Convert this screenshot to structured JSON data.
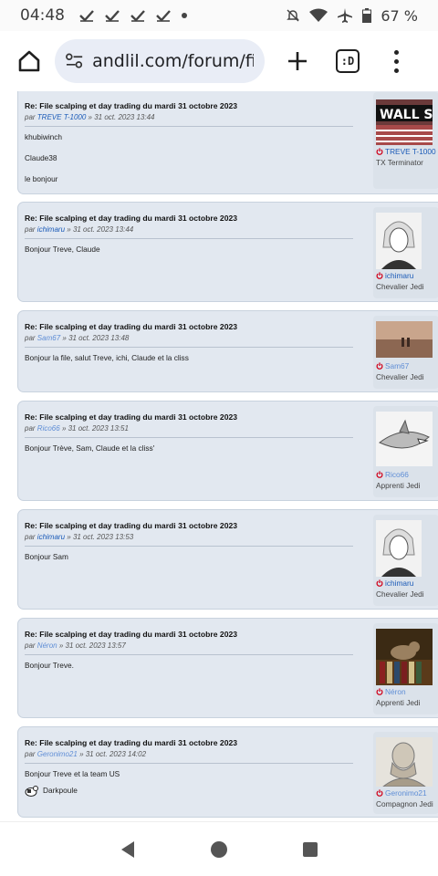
{
  "status": {
    "time": "04:48",
    "battery": "67 %"
  },
  "browser": {
    "url": "andlil.com/forum/fil",
    "tabs_label": ":D"
  },
  "posts": [
    {
      "title": "Re: File scalping et day trading du mardi 31 octobre 2023",
      "by": "par",
      "author": "TREVE T-1000",
      "date": "» 31 oct. 2023 13:44",
      "content": [
        "khubiwinch",
        "Claude38",
        "le bonjour"
      ],
      "username": "TREVE T-1000",
      "rank": "TX Terminator",
      "avatar": "wall-st-avatar",
      "avatar_text": "WALL ST"
    },
    {
      "title": "Re: File scalping et day trading du mardi 31 octobre 2023",
      "by": "par",
      "author": "ichimaru",
      "date": "» 31 oct. 2023 13:44",
      "content": [
        "Bonjour Treve, Claude"
      ],
      "username": "ichimaru",
      "rank": "Chevalier Jedi",
      "avatar": "anime-character-avatar"
    },
    {
      "title": "Re: File scalping et day trading du mardi 31 octobre 2023",
      "by": "par",
      "author": "Sam67",
      "date": "» 31 oct. 2023 13:48",
      "content": [
        "Bonjour la file, salut Treve, ichi, Claude et la cliss"
      ],
      "username": "Sam67",
      "rank": "Chevalier Jedi",
      "avatar": "sunset-desert-avatar"
    },
    {
      "title": "Re: File scalping et day trading du mardi 31 octobre 2023",
      "by": "par",
      "author": "Rico66",
      "date": "» 31 oct. 2023 13:51",
      "content": [
        "Bonjour Trève, Sam, Claude et la cliss'"
      ],
      "username": "Rico66",
      "rank": "Apprenti Jedi",
      "avatar": "shark-avatar"
    },
    {
      "title": "Re: File scalping et day trading du mardi 31 octobre 2023",
      "by": "par",
      "author": "ichimaru",
      "date": "» 31 oct. 2023 13:53",
      "content": [
        "Bonjour Sam"
      ],
      "username": "ichimaru",
      "rank": "Chevalier Jedi",
      "avatar": "anime-character-avatar"
    },
    {
      "title": "Re: File scalping et day trading du mardi 31 octobre 2023",
      "by": "par",
      "author": "Néron",
      "date": "» 31 oct. 2023 13:57",
      "content": [
        "Bonjour Treve."
      ],
      "username": "Néron",
      "rank": "Apprenti Jedi",
      "avatar": "cat-books-avatar"
    },
    {
      "title": "Re: File scalping et day trading du mardi 31 octobre 2023",
      "by": "par",
      "author": "Geronimo21",
      "date": "» 31 oct. 2023 14:02",
      "content": [
        "Bonjour Treve et la team US"
      ],
      "signature": "Darkpoule",
      "username": "Geronimo21",
      "rank": "Compagnon Jedi",
      "avatar": "bust-statue-avatar"
    }
  ],
  "colors": {
    "post_bg": "#e2e8f0",
    "author_link": "#1b5bb8",
    "online_icon": "#d0021b"
  }
}
